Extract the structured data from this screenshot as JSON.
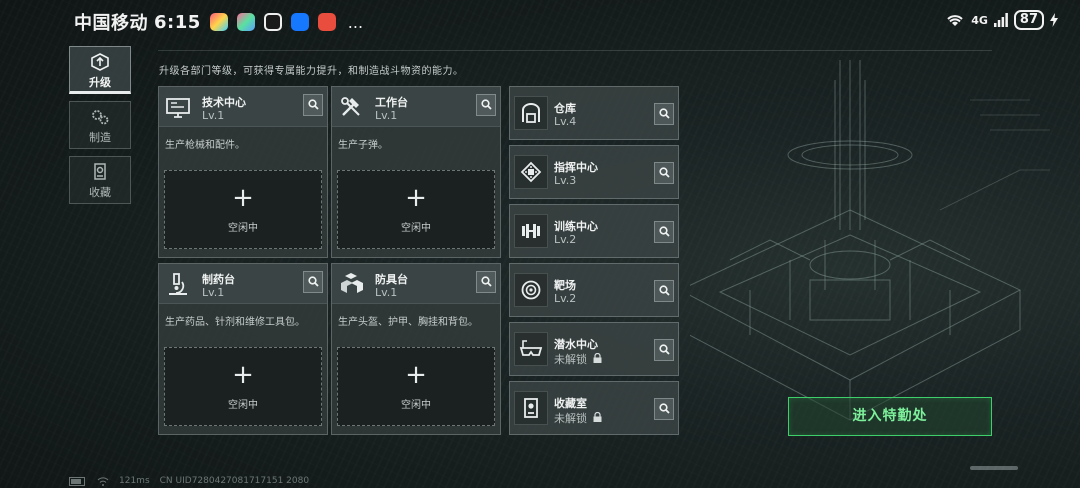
{
  "status_bar": {
    "carrier": "中国移动",
    "time": "6:15",
    "network": "4G",
    "battery": "87",
    "more": "..."
  },
  "sidebar": [
    {
      "label": "升级",
      "icon": "upgrade-icon",
      "active": true
    },
    {
      "label": "制造",
      "icon": "gears-icon",
      "active": false
    },
    {
      "label": "收藏",
      "icon": "collection-icon",
      "active": false
    }
  ],
  "description": "升级各部门等级，可获得专属能力提升，和制造战斗物资的能力。",
  "facilities": [
    {
      "name": "技术中心",
      "level": "Lv.1",
      "desc": "生产枪械和配件。",
      "slot": "空闲中",
      "icon": "computer-icon"
    },
    {
      "name": "工作台",
      "level": "Lv.1",
      "desc": "生产子弹。",
      "slot": "空闲中",
      "icon": "tools-icon"
    },
    {
      "name": "制药台",
      "level": "Lv.1",
      "desc": "生产药品、针剂和维修工具包。",
      "slot": "空闲中",
      "icon": "microscope-icon"
    },
    {
      "name": "防具台",
      "level": "Lv.1",
      "desc": "生产头盔、护甲、胸挂和背包。",
      "slot": "空闲中",
      "icon": "armor-boxes-icon"
    }
  ],
  "departments": [
    {
      "name": "仓库",
      "level": "Lv.4",
      "icon": "warehouse-icon",
      "locked": false
    },
    {
      "name": "指挥中心",
      "level": "Lv.3",
      "icon": "command-chip-icon",
      "locked": false
    },
    {
      "name": "训练中心",
      "level": "Lv.2",
      "icon": "dumbbell-icon",
      "locked": false
    },
    {
      "name": "靶场",
      "level": "Lv.2",
      "icon": "target-icon",
      "locked": false
    },
    {
      "name": "潜水中心",
      "level": "未解锁",
      "icon": "diving-mask-icon",
      "locked": true
    },
    {
      "name": "收藏室",
      "level": "未解锁",
      "icon": "collection-room-icon",
      "locked": true
    }
  ],
  "enter_button": "进入特勤处",
  "footer": {
    "ping": "121ms",
    "uid": "CN UID7280427081717151 2080"
  },
  "colors": {
    "accent_green": "#3fcf6a",
    "panel": "#3c4444",
    "background": "#141b1b"
  }
}
